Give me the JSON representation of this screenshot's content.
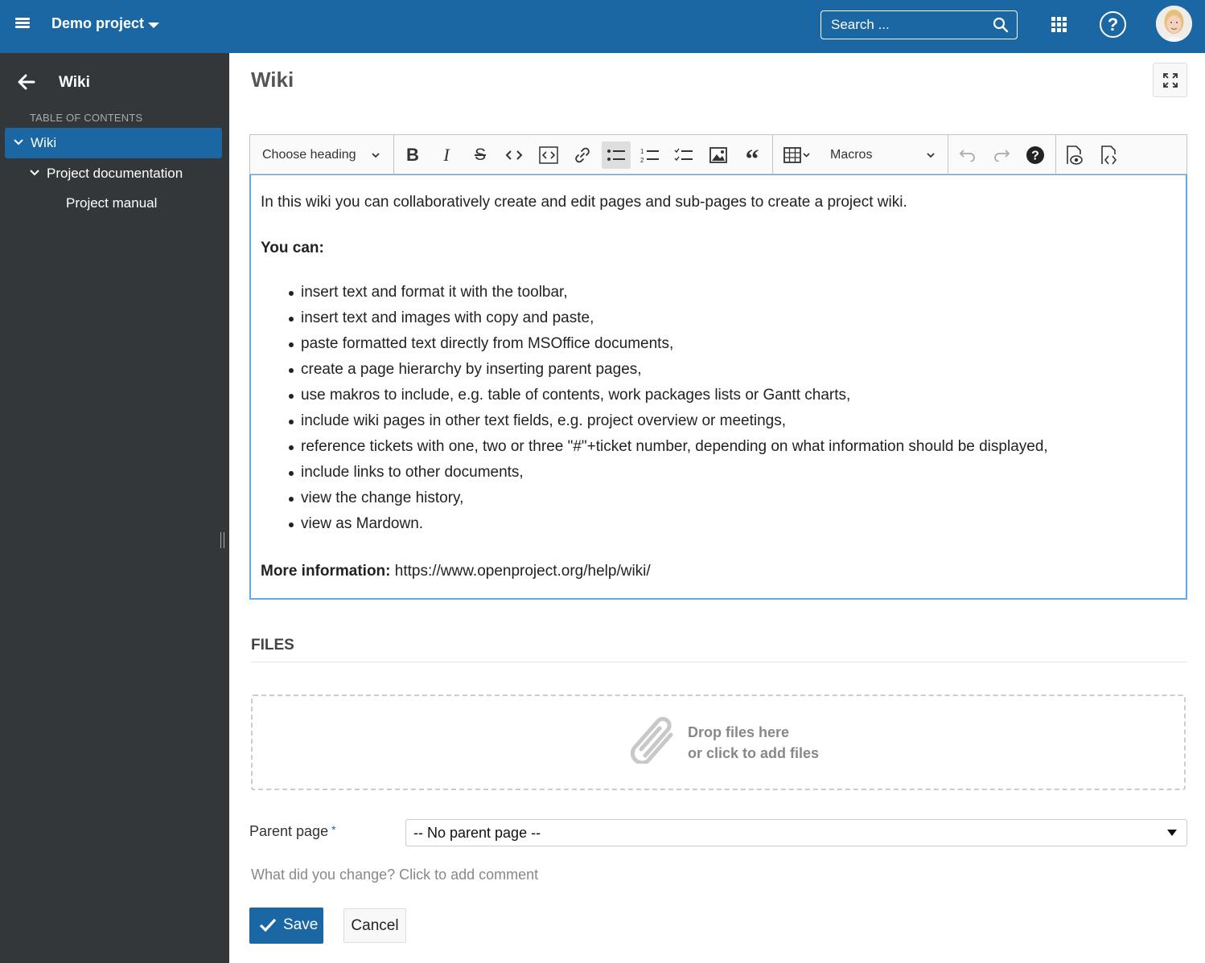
{
  "header": {
    "project_name": "Demo project",
    "search_placeholder": "Search ...",
    "help_label": "?"
  },
  "sidebar": {
    "title": "Wiki",
    "toc_label": "TABLE OF CONTENTS",
    "items": [
      {
        "label": "Wiki",
        "active": true,
        "expanded": true
      },
      {
        "label": "Project documentation",
        "active": false,
        "expanded": true
      },
      {
        "label": "Project manual",
        "active": false
      }
    ]
  },
  "main": {
    "title": "Wiki",
    "toolbar": {
      "heading_dropdown": "Choose heading",
      "macros_dropdown": "Macros",
      "buttons": [
        "bold",
        "italic",
        "strikethrough",
        "code",
        "code-block",
        "link",
        "bulleted-list",
        "numbered-list",
        "todo-list",
        "image",
        "blockquote",
        "table",
        "undo",
        "redo",
        "help",
        "preview",
        "source"
      ],
      "active_button": "bulleted-list"
    },
    "editor": {
      "intro": "In this wiki you can collaboratively create and edit pages and sub-pages to create a project wiki.",
      "you_can": "You can:",
      "list": [
        "insert text and format it with the toolbar,",
        "insert text and images with copy and paste,",
        "paste formatted text directly from MSOffice documents,",
        "create a page hierarchy by inserting parent pages,",
        "use makros to include, e.g. table of contents, work packages lists or Gantt charts,",
        "include wiki pages in other text fields, e.g. project overview or meetings,",
        "reference tickets with one, two or three \"#\"+ticket number, depending on what information should be displayed,",
        "include links to other documents,",
        "view the change history,",
        "view as Mardown."
      ],
      "more_info_label": "More information:",
      "more_info_url": "https://www.openproject.org/help/wiki/"
    },
    "files": {
      "title": "FILES",
      "drop_line1": "Drop files here",
      "drop_line2": "or click to add files"
    },
    "parent_page": {
      "label": "Parent page",
      "required_mark": "*",
      "value": "-- No parent page --"
    },
    "comment_prompt": "What did you change? Click to add comment",
    "save_label": "Save",
    "cancel_label": "Cancel"
  },
  "colors": {
    "brand": "#1a67a3",
    "sidebar_bg": "#333739",
    "editor_focus": "#62a9e8"
  }
}
